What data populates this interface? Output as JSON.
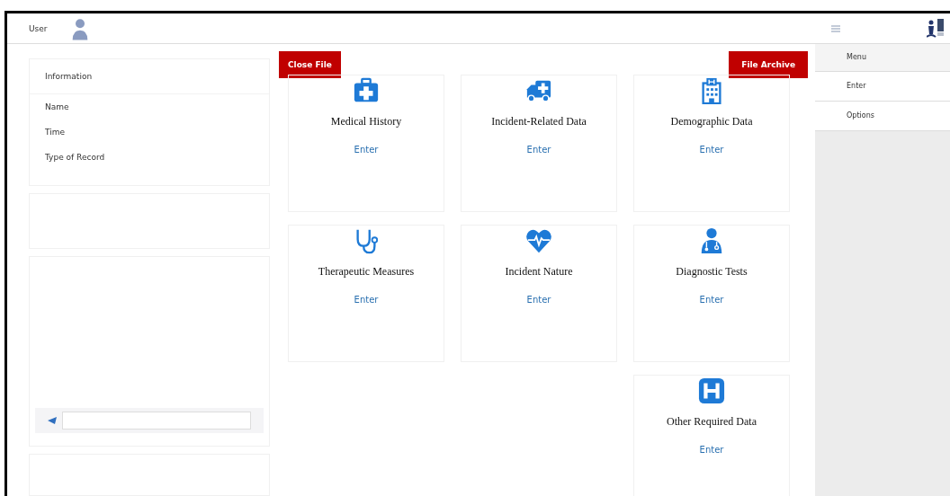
{
  "header": {
    "user_label": "User"
  },
  "info_panel": {
    "title": "Information",
    "fields": [
      "Name",
      "Time",
      "Type of Record"
    ]
  },
  "actions": {
    "close": "Close File",
    "archive": "File Archive"
  },
  "cards": [
    {
      "title": "Medical History",
      "action": "Enter"
    },
    {
      "title": "Incident-Related Data",
      "action": "Enter"
    },
    {
      "title": "Demographic Data",
      "action": "Enter"
    },
    {
      "title": "Therapeutic Measures",
      "action": "Enter"
    },
    {
      "title": "Incident Nature",
      "action": "Enter"
    },
    {
      "title": "Diagnostic Tests",
      "action": "Enter"
    },
    {
      "title": "Other Required Data",
      "action": "Enter"
    }
  ],
  "sidebar": {
    "items": [
      {
        "label": "Menu",
        "kind": "header"
      },
      {
        "label": "Enter",
        "kind": "item"
      },
      {
        "label": "Options",
        "kind": "item"
      }
    ]
  }
}
